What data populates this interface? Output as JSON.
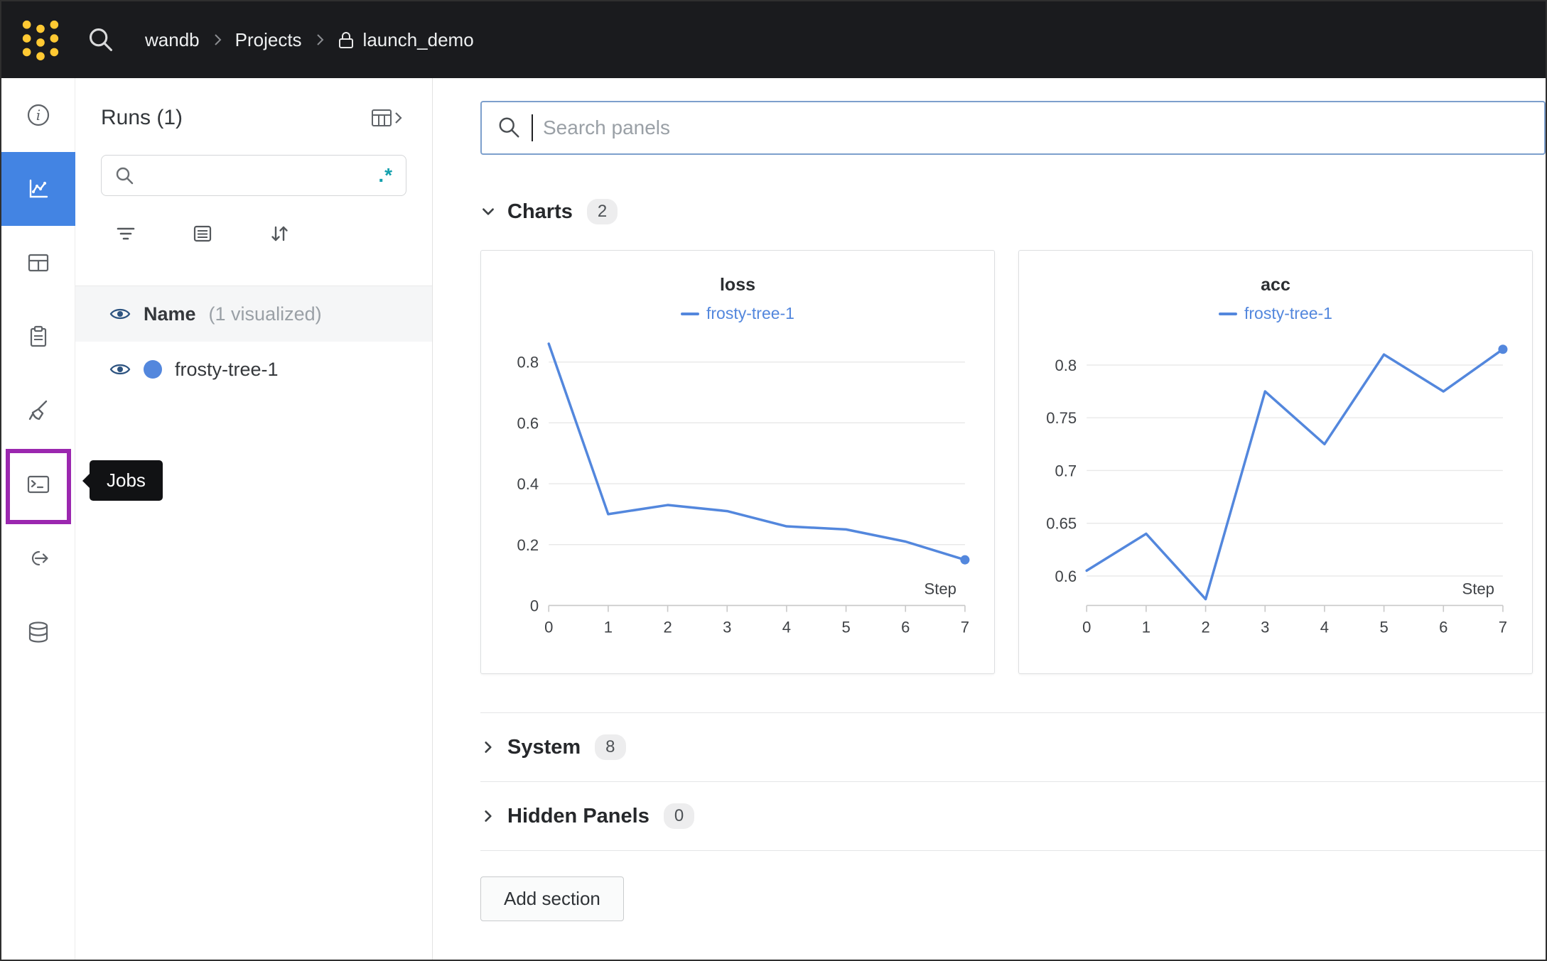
{
  "colors": {
    "brand_yellow": "#ffc933",
    "sidebar_selected_blue": "#4384e3",
    "run_blue": "#5387dd",
    "eye_blue": "#2d5380",
    "regex_teal": "#13a0ad",
    "highlight_purple": "#9b27af",
    "navbar_bg": "#1a1b1e",
    "search_border_blue": "#7d9fcc"
  },
  "navbar": {
    "breadcrumb": {
      "org": "wandb",
      "section": "Projects",
      "project": "launch_demo"
    }
  },
  "sidebar": {
    "tooltip": "Jobs",
    "items": [
      "overview",
      "workspace",
      "table",
      "reports",
      "sweeps",
      "jobs",
      "automations",
      "artifacts"
    ],
    "selected": "workspace",
    "highlighted": "jobs"
  },
  "runs_panel": {
    "title": "Runs (1)",
    "search_value": "",
    "regex_label": ".*",
    "header": {
      "name": "Name",
      "visualized": "(1 visualized)"
    },
    "runs": [
      {
        "name": "frosty-tree-1"
      }
    ]
  },
  "main": {
    "search_placeholder": "Search panels",
    "sections": [
      {
        "label": "Charts",
        "count": "2",
        "expanded": true
      },
      {
        "label": "System",
        "count": "8",
        "expanded": false
      },
      {
        "label": "Hidden Panels",
        "count": "0",
        "expanded": false
      }
    ],
    "add_section_label": "Add section"
  },
  "chart_data": [
    {
      "type": "line",
      "title": "loss",
      "x": [
        0,
        1,
        2,
        3,
        4,
        5,
        6,
        7
      ],
      "xlabel": "Step",
      "yticks": [
        0,
        0.2,
        0.4,
        0.6,
        0.8
      ],
      "ylim": [
        0,
        0.88
      ],
      "grid": true,
      "legend_position": "top",
      "end_marker": true,
      "series": [
        {
          "name": "frosty-tree-1",
          "color": "#5387dd",
          "values": [
            0.86,
            0.3,
            0.33,
            0.31,
            0.26,
            0.25,
            0.21,
            0.15
          ]
        }
      ]
    },
    {
      "type": "line",
      "title": "acc",
      "x": [
        0,
        1,
        2,
        3,
        4,
        5,
        6,
        7
      ],
      "xlabel": "Step",
      "yticks": [
        0.6,
        0.65,
        0.7,
        0.75,
        0.8
      ],
      "ylim": [
        0.572,
        0.826
      ],
      "grid": true,
      "legend_position": "top",
      "end_marker": true,
      "series": [
        {
          "name": "frosty-tree-1",
          "color": "#5387dd",
          "values": [
            0.605,
            0.64,
            0.578,
            0.775,
            0.725,
            0.81,
            0.775,
            0.815
          ]
        }
      ]
    }
  ]
}
